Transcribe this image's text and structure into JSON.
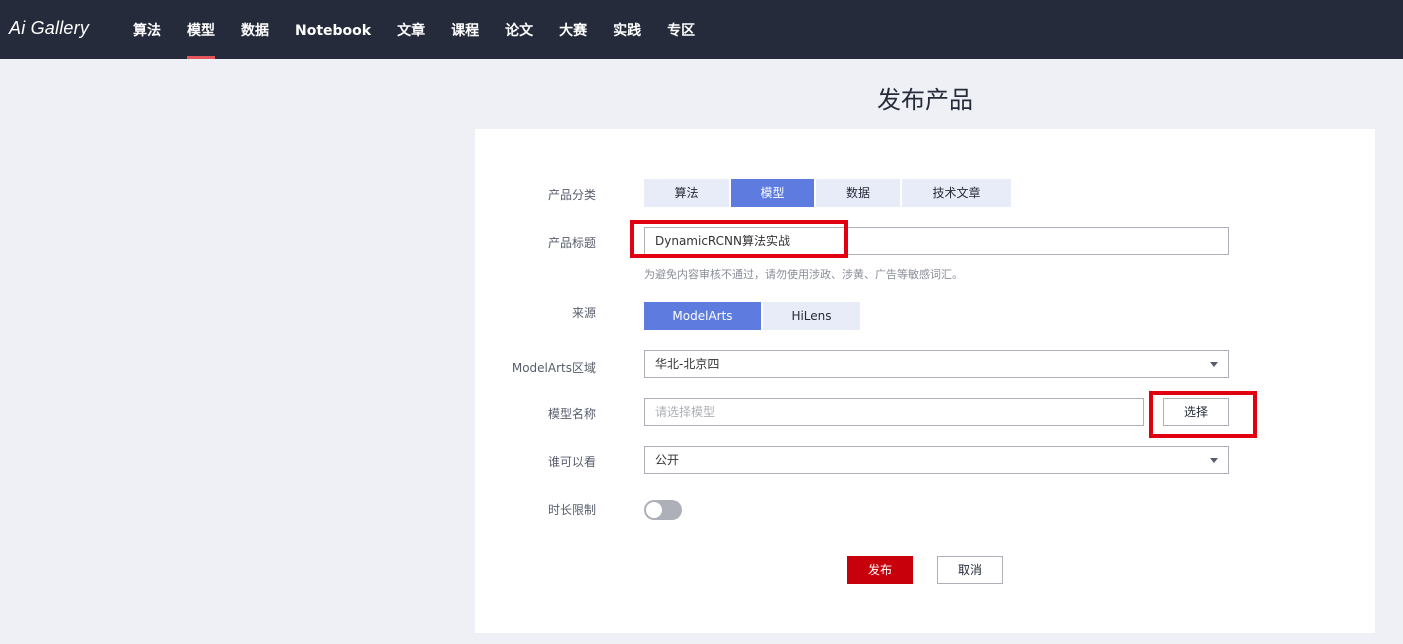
{
  "header": {
    "logo": "Ai Gallery",
    "nav": [
      {
        "label": "算法",
        "active": false
      },
      {
        "label": "模型",
        "active": true
      },
      {
        "label": "数据",
        "active": false
      },
      {
        "label": "Notebook",
        "active": false
      },
      {
        "label": "文章",
        "active": false
      },
      {
        "label": "课程",
        "active": false
      },
      {
        "label": "论文",
        "active": false
      },
      {
        "label": "大赛",
        "active": false
      },
      {
        "label": "实践",
        "active": false
      },
      {
        "label": "专区",
        "active": false
      }
    ]
  },
  "page": {
    "title": "发布产品"
  },
  "form": {
    "category": {
      "label": "产品分类",
      "options": [
        "算法",
        "模型",
        "数据",
        "技术文章"
      ],
      "selected": "模型"
    },
    "title": {
      "label": "产品标题",
      "value": "DynamicRCNN算法实战",
      "hint": "为避免内容审核不通过，请勿使用涉政、涉黄、广告等敏感词汇。"
    },
    "source": {
      "label": "来源",
      "options": [
        "ModelArts",
        "HiLens"
      ],
      "selected": "ModelArts"
    },
    "region": {
      "label": "ModelArts区域",
      "value": "华北-北京四"
    },
    "model": {
      "label": "模型名称",
      "placeholder": "请选择模型",
      "select_button": "选择"
    },
    "visibility": {
      "label": "谁可以看",
      "value": "公开"
    },
    "duration": {
      "label": "时长限制",
      "enabled": false
    },
    "actions": {
      "publish": "发布",
      "cancel": "取消"
    }
  },
  "colors": {
    "header_bg": "#252b3a",
    "accent": "#5e7ce0",
    "primary_button": "#c7000b",
    "highlight_box": "#e0000f"
  }
}
